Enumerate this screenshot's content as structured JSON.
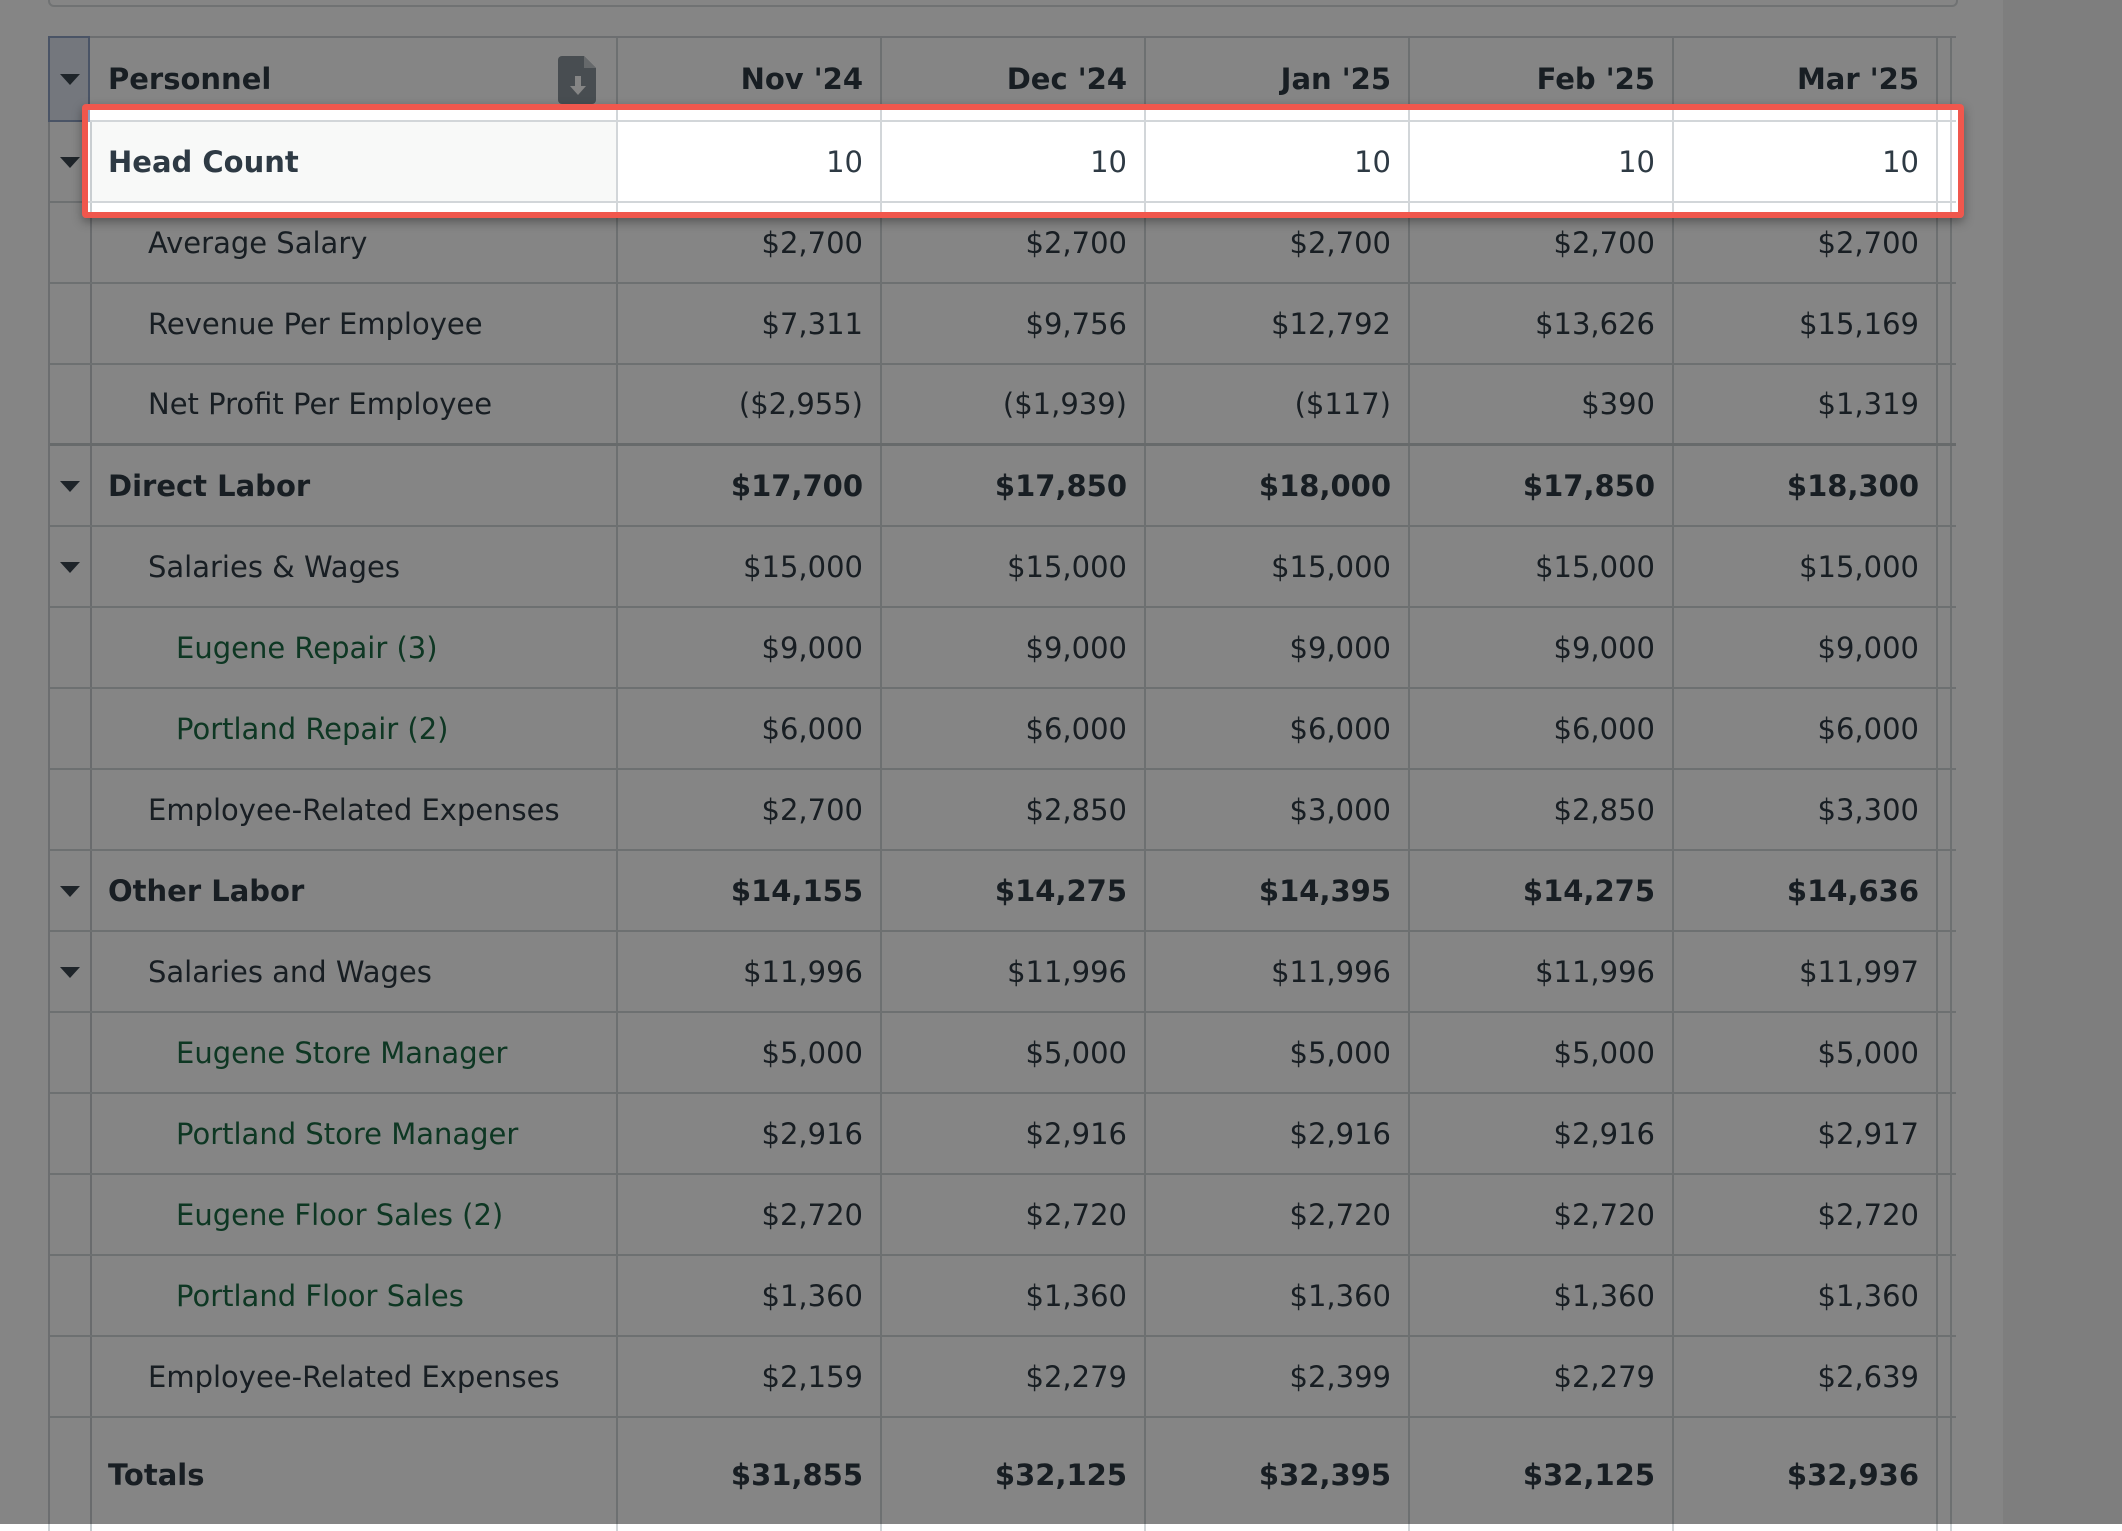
{
  "table": {
    "title": "Personnel",
    "columns": [
      "Nov '24",
      "Dec '24",
      "Jan '25",
      "Feb '25",
      "Mar '25"
    ],
    "rows": [
      {
        "label": "Head Count",
        "values": [
          "10",
          "10",
          "10",
          "10",
          "10"
        ]
      },
      {
        "label": "Average Salary",
        "values": [
          "$2,700",
          "$2,700",
          "$2,700",
          "$2,700",
          "$2,700"
        ]
      },
      {
        "label": "Revenue Per Employee",
        "values": [
          "$7,311",
          "$9,756",
          "$12,792",
          "$13,626",
          "$15,169"
        ]
      },
      {
        "label": "Net Profit Per Employee",
        "values": [
          "($2,955)",
          "($1,939)",
          "($117)",
          "$390",
          "$1,319"
        ]
      },
      {
        "label": "Direct Labor",
        "values": [
          "$17,700",
          "$17,850",
          "$18,000",
          "$17,850",
          "$18,300"
        ]
      },
      {
        "label": "Salaries & Wages",
        "values": [
          "$15,000",
          "$15,000",
          "$15,000",
          "$15,000",
          "$15,000"
        ]
      },
      {
        "label": "Eugene Repair (3)",
        "values": [
          "$9,000",
          "$9,000",
          "$9,000",
          "$9,000",
          "$9,000"
        ]
      },
      {
        "label": "Portland Repair (2)",
        "values": [
          "$6,000",
          "$6,000",
          "$6,000",
          "$6,000",
          "$6,000"
        ]
      },
      {
        "label": "Employee-Related Expenses",
        "values": [
          "$2,700",
          "$2,850",
          "$3,000",
          "$2,850",
          "$3,300"
        ]
      },
      {
        "label": "Other Labor",
        "values": [
          "$14,155",
          "$14,275",
          "$14,395",
          "$14,275",
          "$14,636"
        ]
      },
      {
        "label": "Salaries and Wages",
        "values": [
          "$11,996",
          "$11,996",
          "$11,996",
          "$11,996",
          "$11,997"
        ]
      },
      {
        "label": "Eugene Store Manager",
        "values": [
          "$5,000",
          "$5,000",
          "$5,000",
          "$5,000",
          "$5,000"
        ]
      },
      {
        "label": "Portland Store Manager",
        "values": [
          "$2,916",
          "$2,916",
          "$2,916",
          "$2,916",
          "$2,917"
        ]
      },
      {
        "label": "Eugene Floor Sales (2)",
        "values": [
          "$2,720",
          "$2,720",
          "$2,720",
          "$2,720",
          "$2,720"
        ]
      },
      {
        "label": "Portland Floor Sales",
        "values": [
          "$1,360",
          "$1,360",
          "$1,360",
          "$1,360",
          "$1,360"
        ]
      },
      {
        "label": "Employee-Related Expenses",
        "values": [
          "$2,159",
          "$2,279",
          "$2,399",
          "$2,279",
          "$2,639"
        ]
      },
      {
        "label": "Totals",
        "values": [
          "$31,855",
          "$32,125",
          "$32,395",
          "$32,125",
          "$32,936"
        ]
      }
    ]
  },
  "icons": {
    "export": "file-download-icon",
    "expand": "caret-down-icon"
  },
  "colors": {
    "highlight": "#f0574d",
    "employee_link": "#1c6a44"
  }
}
